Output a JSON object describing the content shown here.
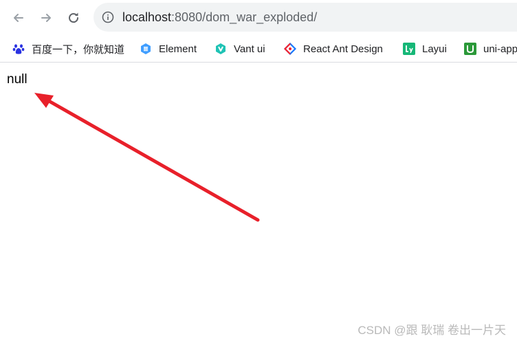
{
  "browser": {
    "url_host": "localhost",
    "url_rest": ":8080/dom_war_exploded/"
  },
  "bookmarks": [
    {
      "label": "百度一下，你就知道",
      "icon": "baidu-paw-icon"
    },
    {
      "label": "Element",
      "icon": "element-logo-icon"
    },
    {
      "label": "Vant ui",
      "icon": "vant-logo-icon"
    },
    {
      "label": "React Ant Design",
      "icon": "ant-design-logo-icon"
    },
    {
      "label": "Layui",
      "icon": "layui-logo-icon"
    },
    {
      "label": "uni-app",
      "icon": "uniapp-logo-icon"
    }
  ],
  "page": {
    "output_text": "null"
  },
  "annotation": {
    "arrow_color": "#e8202a"
  },
  "watermark": {
    "text": "CSDN @跟 耿瑞 卷出一片天"
  }
}
